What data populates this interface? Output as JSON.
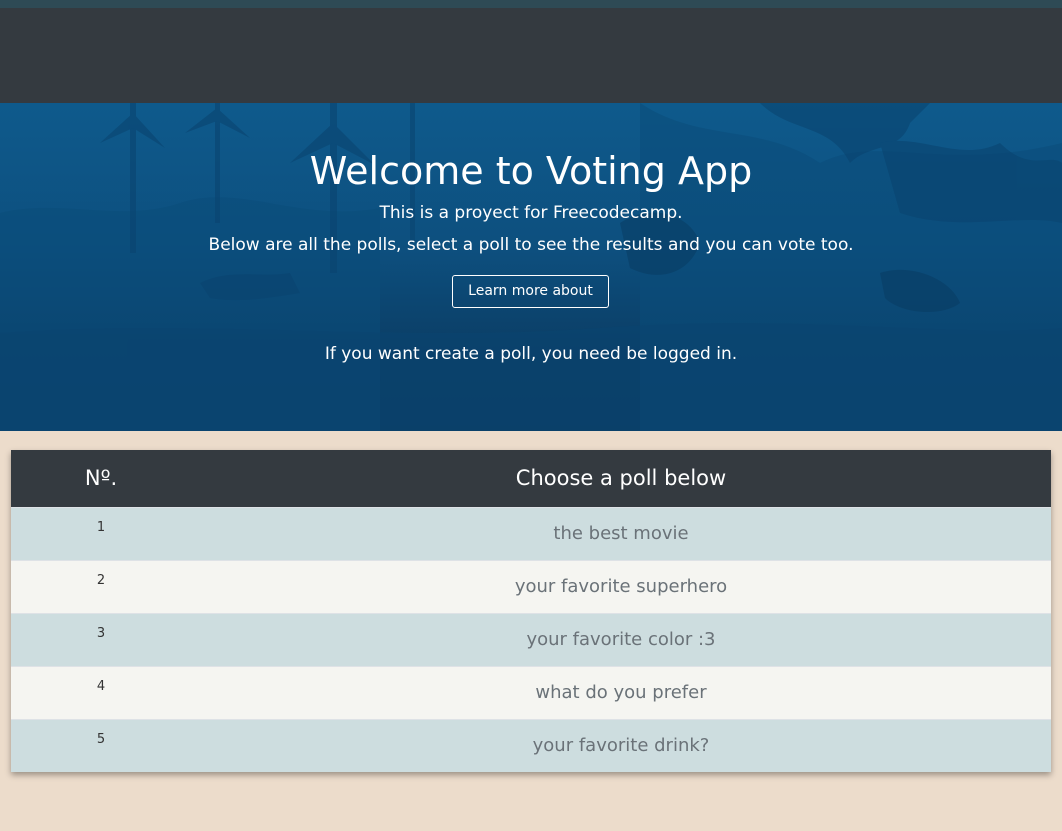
{
  "hero": {
    "title": "Welcome to Voting App",
    "subtitle": "This is a proyect for Freecodecamp.",
    "description": "Below are all the polls, select a poll to see the results and you can vote too.",
    "learn_button": "Learn more about",
    "login_note": "If you want create a poll, you need be logged in."
  },
  "polls_table": {
    "headers": {
      "number": "Nº.",
      "poll": "Choose a poll below"
    },
    "rows": [
      {
        "number": "1",
        "title": "the best movie"
      },
      {
        "number": "2",
        "title": "your favorite superhero"
      },
      {
        "number": "3",
        "title": "your favorite color :3"
      },
      {
        "number": "4",
        "title": "what do you prefer"
      },
      {
        "number": "5",
        "title": "your favorite drink?"
      }
    ]
  },
  "colors": {
    "navbar": "#343a40",
    "hero_top": "#0e5a8c",
    "hero_bottom": "#0a3a60",
    "page_background": "#ecdccb",
    "row_odd": "#cddddf",
    "row_even": "#f5f5f1"
  }
}
